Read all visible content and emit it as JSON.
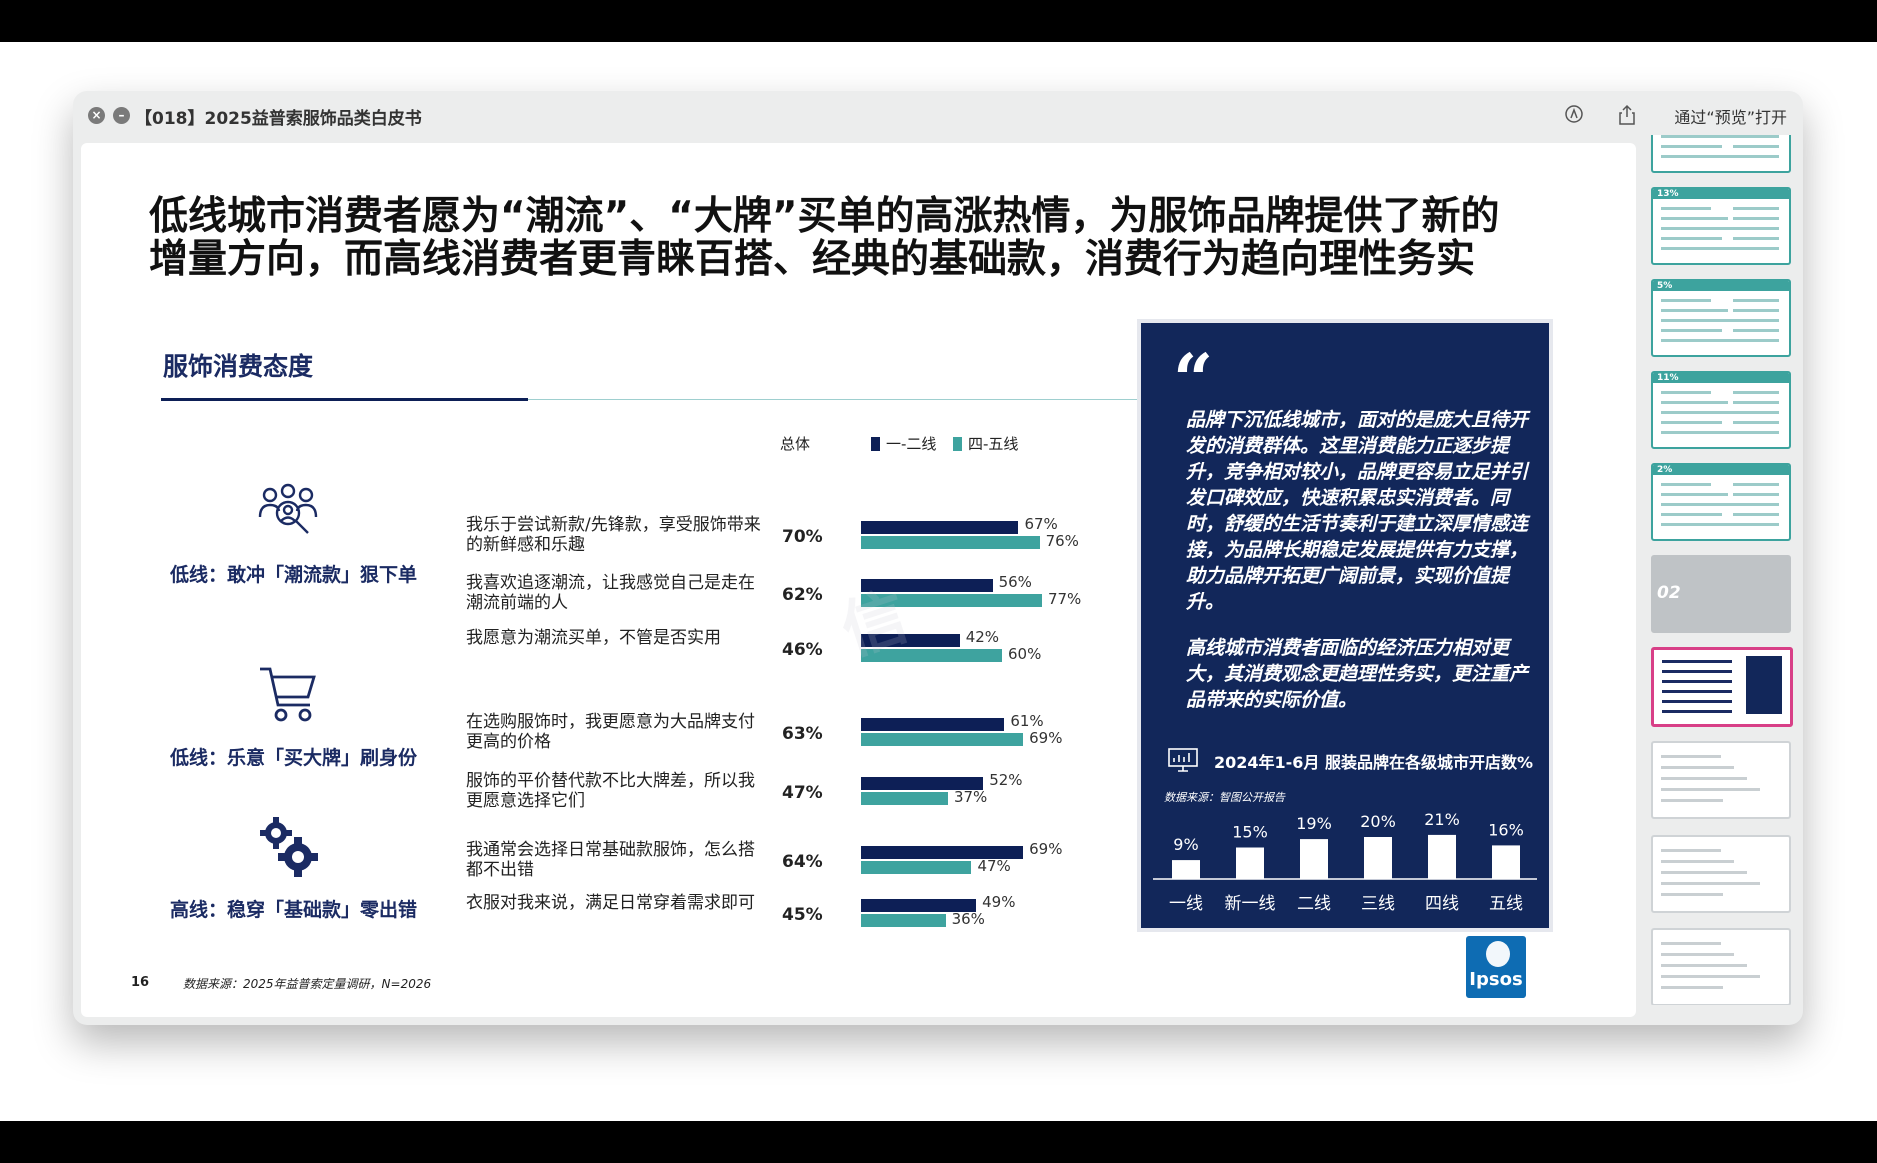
{
  "window": {
    "title": "【018】2025益普索服饰品类白皮书",
    "open_with_label": "通过“预览”打开",
    "close_icon": "close-icon",
    "minimize_icon": "minimize-icon",
    "markup_icon": "markup-icon",
    "share_icon": "share-icon"
  },
  "slide": {
    "headline_line1": "低线城市消费者愿为“潮流”、“大牌”买单的高涨热情，为服饰品牌提供了新的",
    "headline_line2": "增量方向，而高线消费者更青睐百搭、经典的基础款，消费行为趋向理性务实",
    "section_title": "服饰消费态度",
    "legend": {
      "overall": "总体",
      "tier12": "一-二线",
      "tier45": "四-五线"
    },
    "colors": {
      "dark": "#0d1f56",
      "teal": "#3ea39f",
      "navy_box": "#12275a"
    },
    "categories": [
      {
        "icon": "people-search-icon",
        "label": "低线：敢冲「潮流款」狠下单"
      },
      {
        "icon": "shopping-cart-icon",
        "label": "低线：乐意「买大牌」刷身份"
      },
      {
        "icon": "gears-icon",
        "label": "高线：稳穿「基础款」零出错"
      }
    ],
    "page_number": "16",
    "source": "数据来源：2025年益普索定量调研，N=2026",
    "logo_text": "Ipsos"
  },
  "chart_data": [
    {
      "type": "bar",
      "title": "服饰消费态度",
      "series_names": [
        "一-二线",
        "四-五线"
      ],
      "rows": [
        {
          "statement": "我乐于尝试新款/先锋款，享受服饰带来的新鲜感和乐趣",
          "overall": "70%",
          "tier12": 67,
          "tier45": 76
        },
        {
          "statement": "我喜欢追逐潮流，让我感觉自己是走在潮流前端的人",
          "overall": "62%",
          "tier12": 56,
          "tier45": 77
        },
        {
          "statement": "我愿意为潮流买单，不管是否实用",
          "overall": "46%",
          "tier12": 42,
          "tier45": 60
        },
        {
          "statement": "在选购服饰时，我更愿意为大品牌支付更高的价格",
          "overall": "63%",
          "tier12": 61,
          "tier45": 69
        },
        {
          "statement": "服饰的平价替代款不比大牌差，所以我更愿意选择它们",
          "overall": "47%",
          "tier12": 52,
          "tier45": 37
        },
        {
          "statement": "我通常会选择日常基础款服饰，怎么搭都不出错",
          "overall": "64%",
          "tier12": 69,
          "tier45": 47
        },
        {
          "statement": "衣服对我来说，满足日常穿着需求即可",
          "overall": "45%",
          "tier12": 49,
          "tier45": 36
        }
      ]
    },
    {
      "type": "bar",
      "title": "2024年1-6月 服装品牌在各级城市开店数%",
      "source": "数据来源：智图公开报告",
      "categories": [
        "一线",
        "新一线",
        "二线",
        "三线",
        "四线",
        "五线"
      ],
      "values": [
        9,
        15,
        19,
        20,
        21,
        16
      ],
      "value_labels": [
        "9%",
        "15%",
        "19%",
        "20%",
        "21%",
        "16%"
      ]
    }
  ],
  "quote": {
    "mark": "“",
    "p1": "品牌下沉低线城市，面对的是庞大且待开发的消费群体。这里消费能力正逐步提升，竞争相对较小，品牌更容易立足并引发口碑效应，快速积累忠实消费者。同时，舒缓的生活节奏利于建立深厚情感连接，为品牌长期稳定发展提供有力支撑，助力品牌开拓更广阔前景，实现价值提升。",
    "p2": "高线城市消费者面临的经济压力相对更大，其消费观念更趋理性务实，更注重产品带来的实际价值。"
  },
  "thumbnails": {
    "items": [
      {
        "tag": ""
      },
      {
        "tag": "13%"
      },
      {
        "tag": "5%"
      },
      {
        "tag": "11%"
      },
      {
        "tag": "2%"
      },
      {
        "tag": "02"
      },
      {
        "tag": ""
      },
      {
        "tag": ""
      },
      {
        "tag": ""
      },
      {
        "tag": ""
      }
    ]
  }
}
